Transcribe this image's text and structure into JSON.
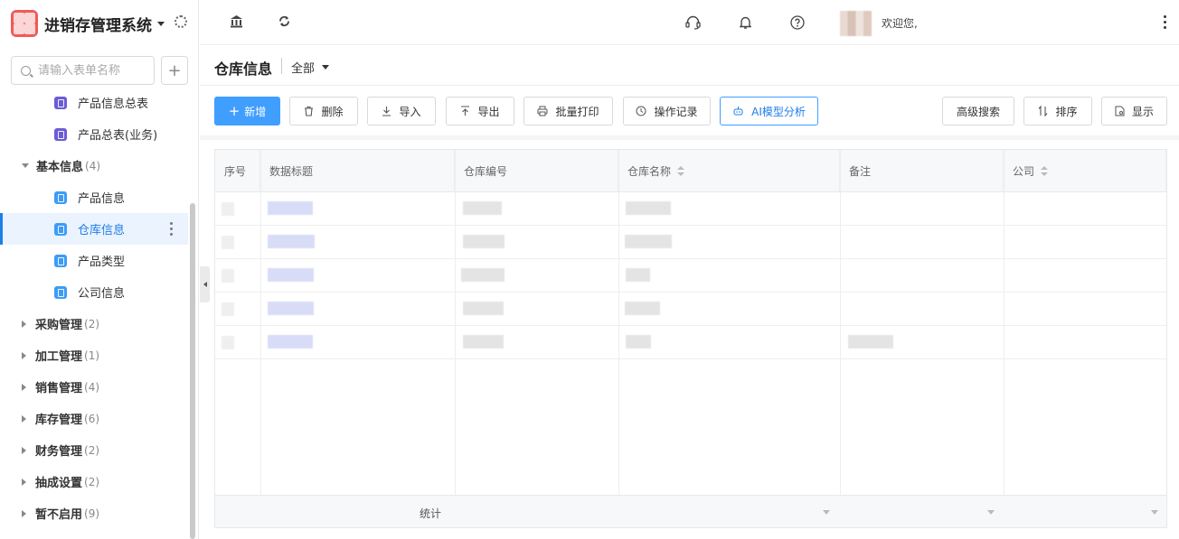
{
  "app": {
    "title": "进销存管理系统"
  },
  "sidebar": {
    "search_placeholder": "请输入表单名称",
    "add_label": "+",
    "items": [
      {
        "label": "产品信息总表",
        "type": "child",
        "icon": "purple-doc-icon"
      },
      {
        "label": "产品总表(业务)",
        "type": "child",
        "icon": "purple-doc-icon"
      },
      {
        "label": "基本信息",
        "count": "(4)",
        "type": "group-open"
      },
      {
        "label": "产品信息",
        "type": "child",
        "icon": "blue-doc-icon"
      },
      {
        "label": "仓库信息",
        "type": "child",
        "icon": "blue-doc-icon",
        "active": true
      },
      {
        "label": "产品类型",
        "type": "child",
        "icon": "blue-doc-icon"
      },
      {
        "label": "公司信息",
        "type": "child",
        "icon": "blue-doc-icon"
      },
      {
        "label": "采购管理",
        "count": "(2)",
        "type": "group"
      },
      {
        "label": "加工管理",
        "count": "(1)",
        "type": "group"
      },
      {
        "label": "销售管理",
        "count": "(4)",
        "type": "group"
      },
      {
        "label": "库存管理",
        "count": "(6)",
        "type": "group"
      },
      {
        "label": "财务管理",
        "count": "(2)",
        "type": "group"
      },
      {
        "label": "抽成设置",
        "count": "(2)",
        "type": "group"
      },
      {
        "label": "暂不启用",
        "count": "(9)",
        "type": "group"
      }
    ]
  },
  "topbar": {
    "icons": [
      "bank-icon",
      "refresh-icon",
      "headset-icon",
      "bell-icon",
      "help-icon"
    ],
    "welcome": "欢迎您,"
  },
  "page": {
    "title": "仓库信息",
    "filter": "全部"
  },
  "toolbar": {
    "new": "新增",
    "delete": "删除",
    "import": "导入",
    "export": "导出",
    "batch_print": "批量打印",
    "op_log": "操作记录",
    "ai": "AI模型分析",
    "advanced_search": "高级搜索",
    "sort": "排序",
    "display": "显示"
  },
  "table": {
    "columns": [
      "序号",
      "数据标题",
      "仓库编号",
      "仓库名称",
      "备注",
      "公司"
    ],
    "sortable": [
      false,
      false,
      false,
      true,
      false,
      true
    ],
    "footer_label": "统计",
    "row_count": 5
  },
  "colors": {
    "primary": "#409eff",
    "active_text": "#1e7ee8",
    "logo": "#f15a5a"
  }
}
